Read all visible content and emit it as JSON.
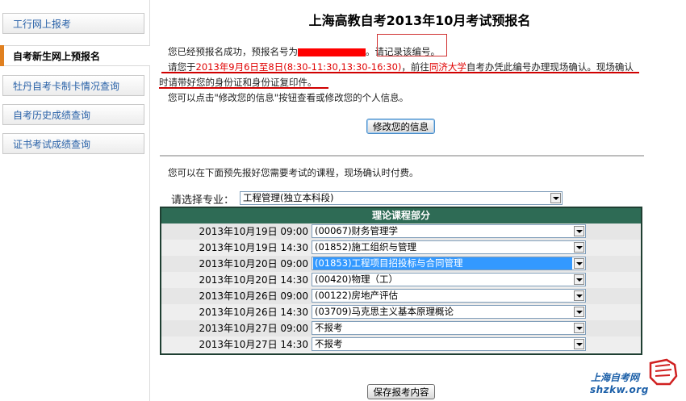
{
  "sidebar": {
    "items": [
      {
        "label": "工行网上报考"
      },
      {
        "label": "自考新生网上预报名"
      },
      {
        "label": "牡丹自考卡制卡情况查询"
      },
      {
        "label": "自考历史成绩查询"
      },
      {
        "label": "证书考试成绩查询"
      }
    ]
  },
  "main": {
    "title": "上海高教自考2013年10月考试预报名",
    "notice": {
      "line1_prefix": "您已经预报名成功，预报名号为",
      "line1_suffix": "。请记录该编号。",
      "line2_a": "请您于",
      "line2_date": "2013年9月6日至8日(8:30-11:30,13:30-16:30)",
      "line2_b": "，前往",
      "line2_school": "同济大学",
      "line2_c": "自考办凭此编号办理现场确认。现场确认",
      "line3": "时请带好您的身份证和身份证复印件。",
      "line4": "您可以点击\"修改您的信息\"按钮查看或修改您的个人信息。"
    },
    "edit_button": "修改您的信息",
    "course_hint": "您可以在下面预先报好您需要考试的课程，现场确认时付费。",
    "major_label": "请选择专业：",
    "major_value": "工程管理(独立本科段)",
    "table": {
      "header": "理论课程部分",
      "rows": [
        {
          "time": "2013年10月19日 09:00",
          "course": "(00067)财务管理学"
        },
        {
          "time": "2013年10月19日 14:30",
          "course": "(01852)施工组织与管理"
        },
        {
          "time": "2013年10月20日 09:00",
          "course": "(01853)工程项目招投标与合同管理"
        },
        {
          "time": "2013年10月20日 14:30",
          "course": "(00420)物理（工）"
        },
        {
          "time": "2013年10月26日 09:00",
          "course": "(00122)房地产评估"
        },
        {
          "time": "2013年10月26日 14:30",
          "course": "(03709)马克思主义基本原理概论"
        },
        {
          "time": "2013年10月27日 09:00",
          "course": "不报考"
        },
        {
          "time": "2013年10月27日 14:30",
          "course": "不报考"
        }
      ]
    },
    "save_button": "保存报考内容"
  },
  "logo": {
    "line1": "上海自考网",
    "line2": "shzkw.org"
  },
  "colors": {
    "accent_orange": "#e08020",
    "header_green": "#2e6b55",
    "notice_red": "#e00000",
    "link_blue": "#2a62a8"
  }
}
